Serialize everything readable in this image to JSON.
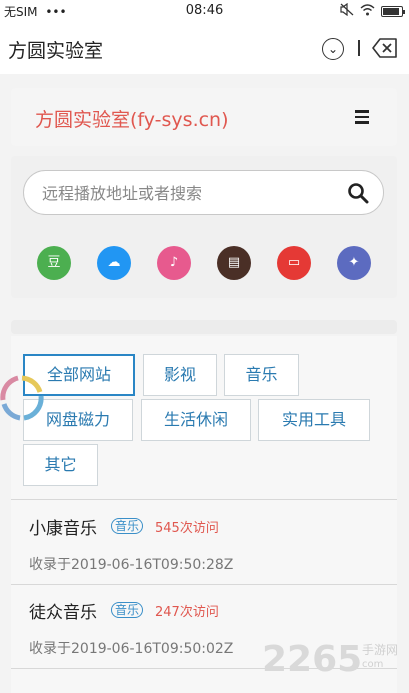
{
  "status_bar": {
    "carrier": "无SIM",
    "dots": "•••",
    "time": "08:46"
  },
  "titlebar": {
    "title": "方圆实验室"
  },
  "site": {
    "name": "方圆实验室(fy-sys.cn)"
  },
  "search": {
    "placeholder": "远程播放地址或者搜索"
  },
  "quick_links": [
    {
      "label": "豆",
      "icon": "douban-icon",
      "color": "#4caf50"
    },
    {
      "label": "☁",
      "icon": "cloud-icon",
      "color": "#2196f3"
    },
    {
      "label": "♪",
      "icon": "music-icon",
      "color": "#e75a8e"
    },
    {
      "label": "▤",
      "icon": "book-icon",
      "color": "#4a2f26"
    },
    {
      "label": "▭",
      "icon": "tv-icon",
      "color": "#e53935"
    },
    {
      "label": "✦",
      "icon": "bird-icon",
      "color": "#5c6bc0"
    }
  ],
  "categories": [
    {
      "label": "全部网站"
    },
    {
      "label": "影视"
    },
    {
      "label": "音乐"
    },
    {
      "label": "网盘磁力"
    },
    {
      "label": "生活休闲"
    },
    {
      "label": "实用工具"
    },
    {
      "label": "其它"
    }
  ],
  "sites": [
    {
      "name": "小康音乐",
      "tag": "音乐",
      "visits": "545次访问",
      "date": "收录于2019-06-16T09:50:28Z"
    },
    {
      "name": "徒众音乐",
      "tag": "音乐",
      "visits": "247次访问",
      "date": "收录于2019-06-16T09:50:02Z"
    }
  ],
  "watermark": {
    "brand": "2265",
    "dot": ".",
    "suffix": "com",
    "label": "手游网"
  },
  "colors": {
    "accent": "#e0574f",
    "link": "#2a86c5"
  }
}
